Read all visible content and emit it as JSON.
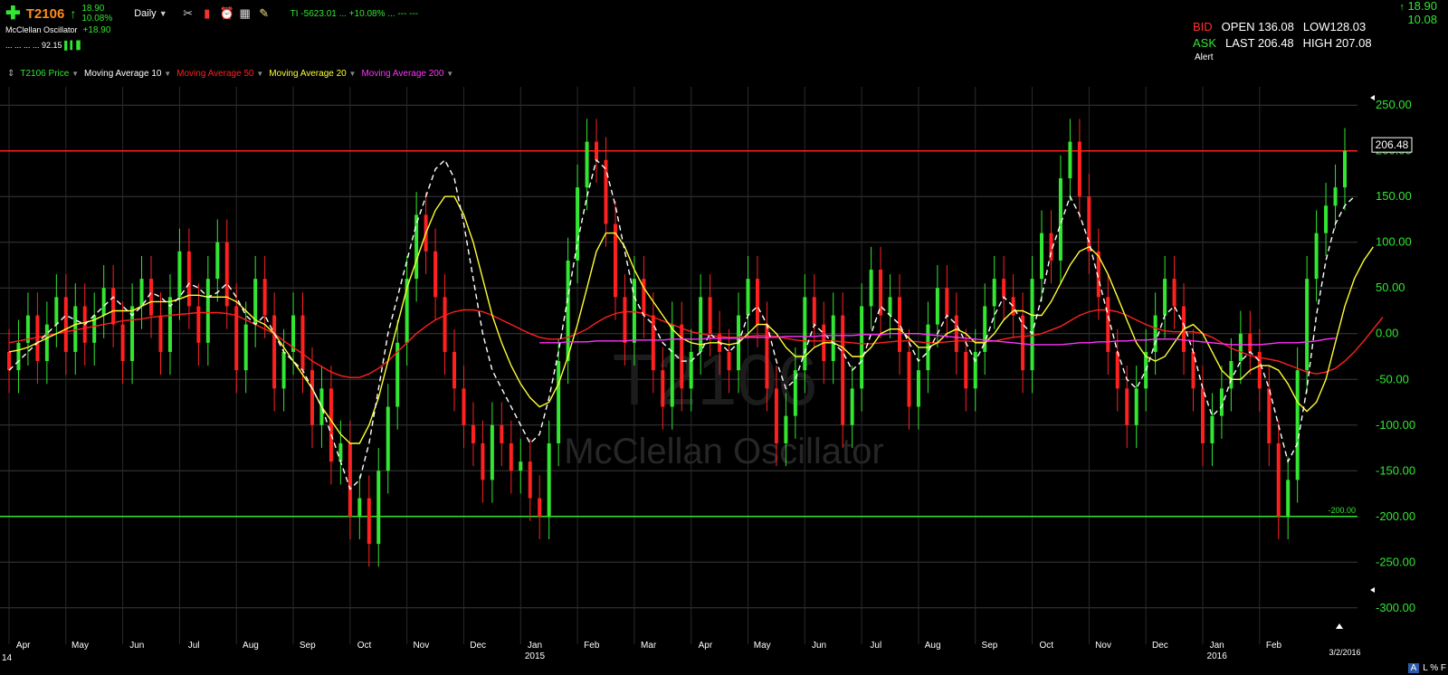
{
  "header": {
    "symbol": "T2106",
    "change_top": "18.90",
    "change_bottom": "10.08%",
    "period": "Daily",
    "ti_text": "TI -5623.01 ... +10.08% ... --- ---",
    "indicator_name": "McClellan Oscillator",
    "indicator_value": "+18.90",
    "sub_text": "... ... ... ...",
    "sub_value": "92.15"
  },
  "quote": {
    "right_top": "18.90",
    "right_bottom": "10.08",
    "bid_label": "BID",
    "ask_label": "ASK",
    "open": "OPEN 136.08",
    "low": "LOW128.03",
    "last": "LAST 206.48",
    "high": "HIGH 207.08",
    "alert": "Alert"
  },
  "legend": [
    {
      "label": "T2106 Price",
      "color": "#32e632"
    },
    {
      "label": "Moving Average 10",
      "color": "#ffffff"
    },
    {
      "label": "Moving Average 50",
      "color": "#ff2020"
    },
    {
      "label": "Moving Average 20",
      "color": "#ffff33"
    },
    {
      "label": "Moving Average 200",
      "color": "#ff33ff"
    }
  ],
  "footer": {
    "a": "A",
    "rest": "L % F"
  },
  "chart_data": {
    "type": "candlestick",
    "watermark_title": "T2106",
    "watermark_subtitle": "McClellan Oscillator",
    "ylim": [
      -320,
      270
    ],
    "yticks": [
      250,
      200,
      150,
      100,
      50,
      0,
      -50,
      -100,
      -150,
      -200,
      -250,
      -300
    ],
    "ytick_labels": [
      "250.00",
      "200.00",
      "150.00",
      "100.00",
      "50.00",
      "0.00",
      "-50.00",
      "-100.00",
      "-150.00",
      "-200.00",
      "-250.00",
      "-300.00"
    ],
    "grid": true,
    "hlines": [
      {
        "value": 200,
        "color": "#ff2020",
        "label": ""
      },
      {
        "value": -200,
        "color": "#32e632",
        "label": "-200.00"
      }
    ],
    "last_value": "206.48",
    "x_start_label": "14",
    "months": [
      {
        "label": "Apr",
        "x": 2.5
      },
      {
        "label": "May",
        "x": 8.5
      },
      {
        "label": "Jun",
        "x": 14.5
      },
      {
        "label": "Jul",
        "x": 20.5
      },
      {
        "label": "Aug",
        "x": 26.5
      },
      {
        "label": "Sep",
        "x": 32.5
      },
      {
        "label": "Oct",
        "x": 38.5
      },
      {
        "label": "Nov",
        "x": 44.5
      },
      {
        "label": "Dec",
        "x": 50.5
      },
      {
        "label": "Jan",
        "x": 56.5,
        "year": "2015"
      },
      {
        "label": "Feb",
        "x": 62.5
      },
      {
        "label": "Mar",
        "x": 68.5
      },
      {
        "label": "Apr",
        "x": 74.5
      },
      {
        "label": "May",
        "x": 80.5
      },
      {
        "label": "Jun",
        "x": 86.5
      },
      {
        "label": "Jul",
        "x": 92.5
      },
      {
        "label": "Aug",
        "x": 98.5
      },
      {
        "label": "Sep",
        "x": 104.5
      },
      {
        "label": "Oct",
        "x": 110.5
      },
      {
        "label": "Nov",
        "x": 116.5
      },
      {
        "label": "Dec",
        "x": 122.5
      },
      {
        "label": "Jan",
        "x": 128.5,
        "year": "2016"
      },
      {
        "label": "Feb",
        "x": 134.5
      }
    ],
    "end_date_label": "3/2/2016",
    "price_close": [
      -40,
      -10,
      20,
      -30,
      10,
      40,
      -20,
      30,
      -10,
      20,
      50,
      10,
      -30,
      30,
      60,
      20,
      -20,
      40,
      90,
      30,
      -10,
      60,
      100,
      30,
      -40,
      10,
      60,
      20,
      -60,
      -20,
      20,
      -40,
      -100,
      -60,
      -140,
      -120,
      -200,
      -180,
      -230,
      -150,
      -80,
      -10,
      60,
      130,
      90,
      40,
      -20,
      -60,
      -100,
      -120,
      -160,
      -100,
      -120,
      -150,
      -140,
      -180,
      -200,
      -120,
      -30,
      80,
      160,
      210,
      190,
      120,
      40,
      -10,
      60,
      20,
      -40,
      -80,
      10,
      -60,
      -20,
      40,
      0,
      -20,
      -40,
      20,
      60,
      10,
      -60,
      -120,
      -90,
      -40,
      40,
      10,
      -30,
      20,
      -100,
      -60,
      30,
      70,
      20,
      40,
      -20,
      -80,
      -40,
      10,
      50,
      20,
      -20,
      -60,
      -20,
      30,
      60,
      40,
      20,
      -40,
      60,
      110,
      80,
      170,
      210,
      150,
      90,
      40,
      -20,
      -60,
      -100,
      -60,
      -20,
      20,
      60,
      30,
      -20,
      -60,
      -120,
      -90,
      -60,
      -30,
      0,
      -20,
      -60,
      -120,
      -200,
      -160,
      -40,
      60,
      110,
      140,
      160,
      200
    ],
    "price_open": [
      -20,
      -40,
      -10,
      20,
      -30,
      10,
      40,
      -20,
      30,
      -10,
      20,
      50,
      10,
      -30,
      30,
      60,
      20,
      -20,
      40,
      90,
      30,
      -10,
      60,
      100,
      30,
      -40,
      10,
      60,
      20,
      -60,
      -20,
      20,
      -40,
      -100,
      -60,
      -140,
      -120,
      -200,
      -180,
      -230,
      -150,
      -80,
      -10,
      60,
      130,
      90,
      40,
      -20,
      -60,
      -100,
      -120,
      -160,
      -100,
      -120,
      -150,
      -140,
      -180,
      -200,
      -120,
      -30,
      80,
      160,
      210,
      190,
      120,
      40,
      -10,
      60,
      20,
      -40,
      -80,
      10,
      -60,
      -20,
      40,
      0,
      -20,
      -40,
      20,
      60,
      10,
      -60,
      -120,
      -90,
      -40,
      40,
      10,
      -30,
      20,
      -100,
      -60,
      30,
      70,
      20,
      40,
      -20,
      -80,
      -40,
      10,
      50,
      20,
      -20,
      -60,
      -20,
      30,
      60,
      40,
      20,
      -40,
      60,
      110,
      80,
      170,
      210,
      150,
      90,
      40,
      -20,
      -60,
      -100,
      -60,
      -20,
      20,
      60,
      30,
      -20,
      -60,
      -120,
      -90,
      -60,
      -30,
      0,
      -20,
      -60,
      -120,
      -200,
      -160,
      -40,
      60,
      110,
      140,
      160
    ],
    "ma10": [
      -40,
      -30,
      -20,
      -10,
      0,
      10,
      20,
      15,
      10,
      20,
      30,
      40,
      30,
      20,
      30,
      45,
      40,
      30,
      40,
      55,
      50,
      40,
      45,
      55,
      40,
      20,
      10,
      20,
      0,
      -20,
      -30,
      -40,
      -60,
      -80,
      -110,
      -140,
      -170,
      -160,
      -120,
      -60,
      0,
      40,
      80,
      120,
      150,
      180,
      190,
      170,
      120,
      60,
      0,
      -40,
      -60,
      -80,
      -100,
      -120,
      -110,
      -70,
      -20,
      40,
      100,
      150,
      190,
      180,
      140,
      90,
      40,
      20,
      10,
      -10,
      -20,
      -30,
      -30,
      -20,
      0,
      -10,
      -20,
      -10,
      20,
      30,
      10,
      -30,
      -60,
      -50,
      -20,
      10,
      0,
      -10,
      -20,
      -40,
      -30,
      0,
      30,
      20,
      10,
      -10,
      -30,
      -20,
      0,
      20,
      10,
      -10,
      -30,
      -10,
      20,
      40,
      30,
      10,
      0,
      40,
      90,
      120,
      150,
      130,
      100,
      60,
      20,
      -20,
      -50,
      -60,
      -40,
      -10,
      20,
      30,
      10,
      -20,
      -60,
      -90,
      -80,
      -50,
      -30,
      -20,
      -30,
      -60,
      -100,
      -140,
      -120,
      -60,
      20,
      80,
      120,
      140,
      150
    ],
    "ma20": [
      -20,
      -18,
      -15,
      -10,
      -5,
      0,
      5,
      10,
      12,
      15,
      20,
      25,
      25,
      25,
      30,
      35,
      35,
      35,
      38,
      42,
      42,
      40,
      40,
      40,
      35,
      25,
      15,
      10,
      0,
      -15,
      -30,
      -45,
      -60,
      -80,
      -95,
      -110,
      -120,
      -120,
      -100,
      -70,
      -30,
      10,
      50,
      80,
      110,
      135,
      150,
      150,
      130,
      100,
      60,
      20,
      -10,
      -35,
      -55,
      -70,
      -80,
      -75,
      -55,
      -25,
      10,
      50,
      90,
      110,
      110,
      95,
      70,
      50,
      35,
      20,
      5,
      -5,
      -10,
      -12,
      -10,
      -10,
      -12,
      -10,
      0,
      10,
      10,
      0,
      -15,
      -25,
      -25,
      -15,
      -10,
      -10,
      -15,
      -25,
      -25,
      -15,
      0,
      5,
      5,
      -5,
      -15,
      -15,
      -10,
      0,
      5,
      0,
      -10,
      -10,
      0,
      15,
      25,
      25,
      20,
      20,
      35,
      55,
      75,
      90,
      95,
      85,
      65,
      40,
      15,
      -10,
      -25,
      -30,
      -25,
      -10,
      5,
      10,
      0,
      -20,
      -40,
      -50,
      -50,
      -40,
      -35,
      -35,
      -40,
      -55,
      -75,
      -85,
      -75,
      -50,
      -10,
      30,
      60,
      80,
      95
    ],
    "ma50": [
      -10,
      -8,
      -6,
      -4,
      -2,
      0,
      2,
      4,
      6,
      8,
      10,
      12,
      14,
      15,
      16,
      18,
      19,
      20,
      21,
      22,
      23,
      23,
      23,
      22,
      20,
      15,
      10,
      5,
      0,
      -8,
      -15,
      -22,
      -30,
      -36,
      -42,
      -46,
      -48,
      -48,
      -44,
      -38,
      -30,
      -20,
      -10,
      0,
      8,
      15,
      20,
      24,
      26,
      26,
      24,
      20,
      15,
      10,
      5,
      0,
      -4,
      -6,
      -6,
      -4,
      0,
      5,
      12,
      18,
      22,
      24,
      24,
      22,
      18,
      14,
      10,
      6,
      2,
      0,
      -2,
      -3,
      -4,
      -4,
      -3,
      -2,
      -2,
      -3,
      -5,
      -7,
      -8,
      -8,
      -8,
      -8,
      -9,
      -10,
      -11,
      -11,
      -10,
      -9,
      -8,
      -8,
      -9,
      -10,
      -10,
      -9,
      -8,
      -8,
      -9,
      -9,
      -8,
      -6,
      -4,
      -3,
      -2,
      0,
      4,
      8,
      14,
      20,
      24,
      26,
      26,
      24,
      20,
      15,
      10,
      6,
      3,
      2,
      2,
      2,
      0,
      -4,
      -10,
      -16,
      -20,
      -24,
      -26,
      -28,
      -30,
      -34,
      -38,
      -42,
      -44,
      -42,
      -38,
      -30,
      -20,
      -8,
      5,
      18
    ],
    "ma200_start": 56,
    "ma200": [
      -10,
      -10,
      -10,
      -9,
      -9,
      -9,
      -8,
      -8,
      -8,
      -8,
      -7,
      -7,
      -7,
      -7,
      -6,
      -6,
      -6,
      -6,
      -5,
      -5,
      -5,
      -5,
      -4,
      -4,
      -4,
      -4,
      -3,
      -3,
      -3,
      -3,
      -2,
      -2,
      -2,
      -2,
      -1,
      -1,
      -1,
      0,
      0,
      0,
      0,
      -1,
      -2,
      -3,
      -4,
      -5,
      -6,
      -7,
      -8,
      -9,
      -10,
      -11,
      -12,
      -12,
      -12,
      -12,
      -11,
      -10,
      -10,
      -9,
      -9,
      -8,
      -8,
      -7,
      -7,
      -6,
      -6,
      -6,
      -7,
      -8,
      -9,
      -10,
      -11,
      -12,
      -12,
      -12,
      -12,
      -11,
      -10,
      -10,
      -10,
      -9,
      -8,
      -6,
      -5
    ]
  }
}
